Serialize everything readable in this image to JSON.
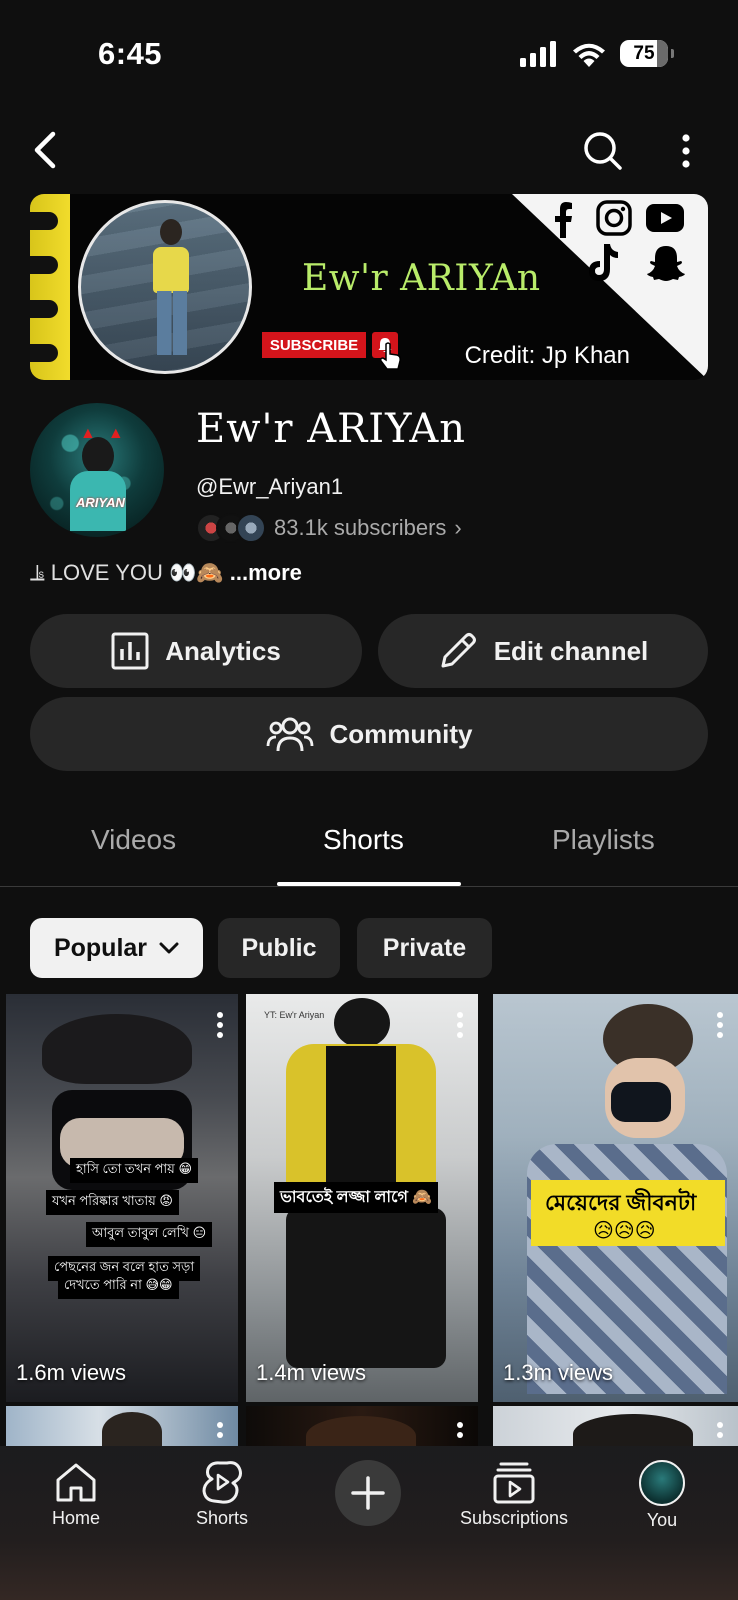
{
  "status": {
    "time": "6:45",
    "battery": "75"
  },
  "banner": {
    "title": "Ew'r ARIYAn",
    "subscribe": "SUBSCRIBE",
    "credit": "Credit: Jp Khan"
  },
  "channel": {
    "name": "Ew'r ARIYAn",
    "handle": "@Ewr_Ariyan1",
    "subscribers": "83.1k subscribers",
    "description": "⫡ LOVE YOU 👀🙈",
    "more": "...more"
  },
  "actions": {
    "analytics": "Analytics",
    "edit_channel": "Edit channel",
    "community": "Community"
  },
  "tabs": [
    "Videos",
    "Shorts",
    "Playlists"
  ],
  "chips": [
    "Popular",
    "Public",
    "Private"
  ],
  "shorts": [
    {
      "views": "1.6m views",
      "captions": [
        "হাসি তো তখন পায় 😁",
        "যখন পরিষ্কার খাতায় 😡",
        "আবুল তাবুল লেখি 😑",
        "পেছনের জন বলে হাত সড়া",
        "দেখতে পারি না 😅😁"
      ]
    },
    {
      "views": "1.4m views",
      "captions": [
        "ভাবতেই লজ্জা লাগে 🙈",
        "YT: Ew'r Ariyan"
      ]
    },
    {
      "views": "1.3m views",
      "captions": [
        "মেয়েদের জীবনটা",
        "😥😥😥"
      ]
    }
  ],
  "nav": {
    "home": "Home",
    "shorts": "Shorts",
    "subscriptions": "Subscriptions",
    "you": "You"
  }
}
